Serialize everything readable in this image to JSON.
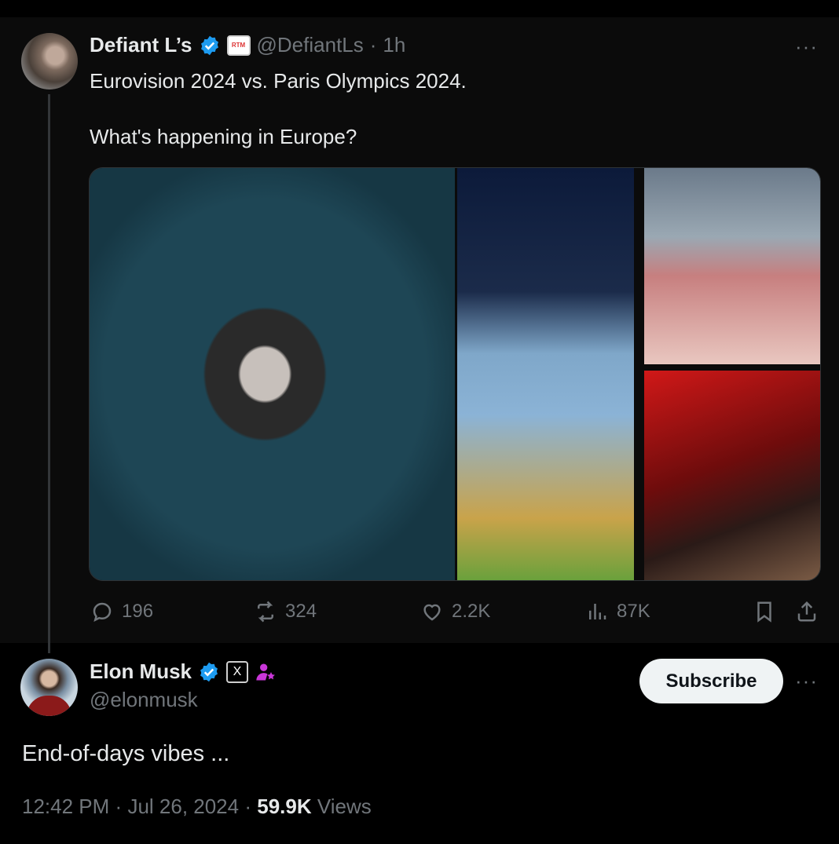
{
  "quoted_tweet": {
    "author_name": "Defiant L’s",
    "handle": "@DefiantLs",
    "separator": "·",
    "time": "1h",
    "affiliate_badge": "RTM",
    "more": "···",
    "text_line1": "Eurovision 2024 vs. Paris Olympics 2024.",
    "text_line2": "What's happening in Europe?",
    "stats": {
      "replies": "196",
      "reposts": "324",
      "likes": "2.2K",
      "views": "87K"
    }
  },
  "main_tweet": {
    "author_name": "Elon Musk",
    "handle": "@elonmusk",
    "affiliate_badge": "X",
    "subscribe_label": "Subscribe",
    "more": "···",
    "text": "End-of-days vibes ...",
    "time": "12:42 PM",
    "dot1": "·",
    "date": "Jul 26, 2024",
    "dot2": "·",
    "views_count": "59.9K",
    "views_label": "Views"
  },
  "colors": {
    "background": "#000000",
    "text": "#e7e9ea",
    "muted": "#71767b",
    "verified": "#1d9bf0",
    "subscriber_icon": "#c936d8"
  },
  "icons": [
    "verified-icon",
    "reply-icon",
    "repost-icon",
    "like-icon",
    "views-icon",
    "bookmark-icon",
    "share-icon",
    "subscriber-icon"
  ]
}
